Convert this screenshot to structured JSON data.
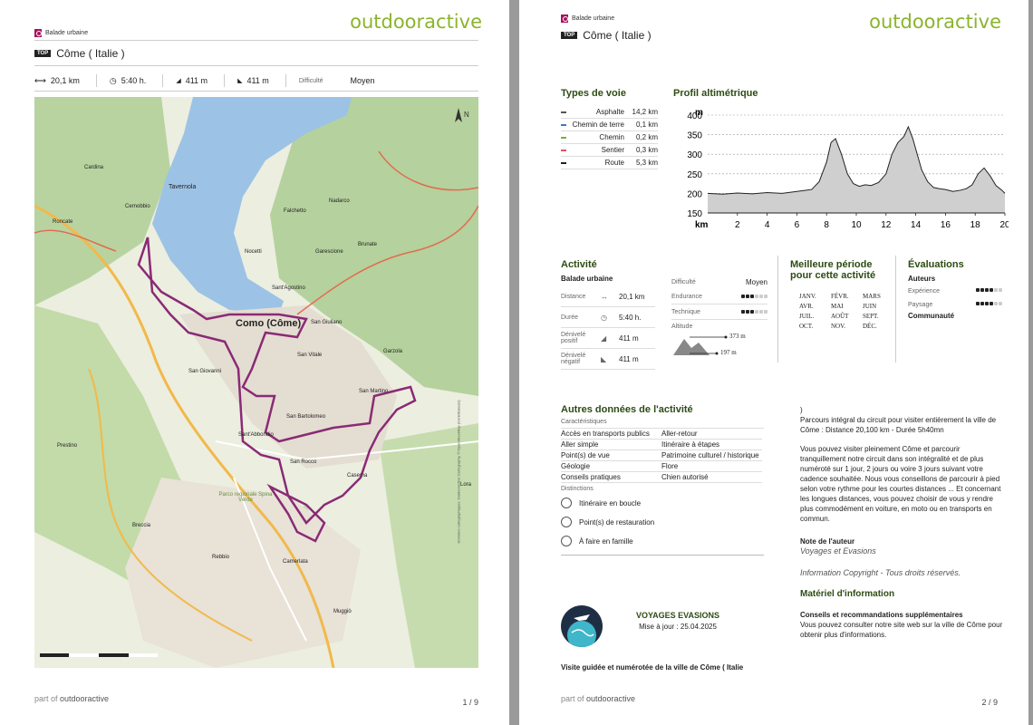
{
  "brand": "outdooractive",
  "page1": {
    "category": "Balade urbaine",
    "top_tag": "TOP",
    "title": "Côme ( Italie )",
    "stats": {
      "distance": "20,1 km",
      "duration": "5:40 h.",
      "ascent": "411 m",
      "descent": "411 m",
      "difficulty_label": "Difficulté",
      "difficulty": "Moyen"
    },
    "map": {
      "labels": [
        "Tavernola",
        "Cardina",
        "Roncate",
        "Cernobbio",
        "Nocetti",
        "Falchetto",
        "Nadarco",
        "Brunate",
        "Garescione",
        "Sant'Agostino",
        "Como (Côme)",
        "San Giuliano",
        "San Vitale",
        "San Giovanni",
        "San Martino",
        "San Bartolomeo",
        "Garzola",
        "Sant'Abbondio",
        "Prestino",
        "San Rocco",
        "Casema",
        "Breccia",
        "Rebbio",
        "Camerlata",
        "Muggiò",
        "Lora",
        "Parco regionale Spina Verde"
      ],
      "attribution": "Données cartographiques: Outdooractive Cartography, © OpenStreetMap (Contributeurs)"
    },
    "footer_prefix": "part of",
    "footer_brand": "outdooractive",
    "page_num": "1 / 9"
  },
  "page2": {
    "category": "Balade urbaine",
    "top_tag": "TOP",
    "title": "Côme ( Italie )",
    "surface_title": "Types de voie",
    "surfaces": [
      {
        "name": "Asphalte",
        "value": "14,2 km",
        "color": "#555555"
      },
      {
        "name": "Chemin de terre",
        "value": "0,1 km",
        "color": "#3a78c9"
      },
      {
        "name": "Chemin",
        "value": "0,2 km",
        "color": "#6fb43a"
      },
      {
        "name": "Sentier",
        "value": "0,3 km",
        "color": "#e05555"
      },
      {
        "name": "Route",
        "value": "5,3 km",
        "color": "#222222"
      }
    ],
    "profile_title": "Profil altimétrique",
    "chart_data": {
      "type": "area",
      "title": "Profil altimétrique",
      "xlabel": "km",
      "ylabel": "m",
      "xlim": [
        0,
        20
      ],
      "ylim": [
        150,
        400
      ],
      "xticks": [
        2,
        4,
        6,
        8,
        10,
        12,
        14,
        16,
        18,
        20
      ],
      "yticks": [
        150,
        200,
        250,
        300,
        350,
        400
      ],
      "x": [
        0,
        1,
        2,
        3,
        4,
        5,
        6,
        7,
        7.5,
        8,
        8.3,
        8.6,
        9,
        9.4,
        9.8,
        10.2,
        10.6,
        11,
        11.5,
        12,
        12.4,
        12.8,
        13.2,
        13.5,
        13.8,
        14.1,
        14.4,
        14.8,
        15.2,
        15.6,
        16,
        16.5,
        17,
        17.4,
        17.8,
        18.2,
        18.6,
        19,
        19.4,
        19.8,
        20
      ],
      "y": [
        200,
        198,
        201,
        199,
        202,
        200,
        205,
        210,
        230,
        280,
        330,
        340,
        300,
        250,
        225,
        218,
        222,
        220,
        228,
        250,
        300,
        330,
        345,
        370,
        340,
        300,
        260,
        230,
        215,
        212,
        210,
        205,
        208,
        212,
        222,
        250,
        265,
        245,
        220,
        208,
        200
      ],
      "grid": true
    },
    "activity": {
      "title": "Activité",
      "type": "Balade urbaine",
      "rows": [
        {
          "label": "Distance",
          "icon": "↔",
          "value": "20,1 km"
        },
        {
          "label": "Durée",
          "icon": "◷",
          "value": "5:40 h."
        },
        {
          "label": "Dénivelé positif",
          "icon": "◢",
          "value": "411 m"
        },
        {
          "label": "Dénivelé négatif",
          "icon": "◣",
          "value": "411 m"
        }
      ],
      "difficulty_label": "Difficulté",
      "difficulty_value": "Moyen",
      "endurance_label": "Endurance",
      "endurance_level": 3,
      "technique_label": "Technique",
      "technique_level": 3,
      "altitude_label": "Altitude",
      "alt_max": "373 m",
      "alt_min": "197 m"
    },
    "season": {
      "title": "Meilleure période pour cette activité",
      "months": [
        "JANV.",
        "FÉVR.",
        "MARS",
        "AVR.",
        "MAI",
        "JUIN",
        "JUIL.",
        "AOÛT",
        "SEPT.",
        "OCT.",
        "NOV.",
        "DÉC."
      ]
    },
    "ratings": {
      "title": "Évaluations",
      "authors_label": "Auteurs",
      "experience_label": "Expérience",
      "experience_level": 4,
      "landscape_label": "Paysage",
      "landscape_level": 4,
      "community_label": "Communauté"
    },
    "other": {
      "title": "Autres données de l'activité",
      "characteristics_label": "Caractéristiques",
      "characteristics": [
        [
          "Accès en transports publics",
          "Aller-retour"
        ],
        [
          "Aller simple",
          "Itinéraire à étapes"
        ],
        [
          "Point(s) de vue",
          "Patrimoine culturel / historique"
        ],
        [
          "Géologie",
          "Flore"
        ],
        [
          "Conseils pratiques",
          "Chien autorisé"
        ]
      ],
      "distinctions_label": "Distinctions",
      "distinctions": [
        "Itinéraire en boucle",
        "Point(s) de restauration",
        "À faire en famille"
      ]
    },
    "author": {
      "name": "VOYAGES EVASIONS",
      "updated": "Mise à jour : 25.04.2025"
    },
    "bottom_title": "Visite guidée et numérotée de la ville de Côme ( Italie",
    "desc": {
      "p0": ")",
      "p1": "Parcours intégral du circuit pour visiter entièrement la ville de Côme : Distance 20,100 km - Durée 5h40mn",
      "p2": "Vous pouvez visiter pleinement Côme et parcourir tranquillement notre circuit dans son intégralité et de plus numéroté sur 1 jour, 2 jours ou voire 3 jours suivant votre cadence souhaitée. Nous vous conseillons de parcourir à pied selon votre rythme pour les courtes distances ... Et concernant les longues distances, vous pouvez choisir de vous y rendre plus commodément en voiture, en moto ou en transports en commun.",
      "note_title": "Note de l'auteur",
      "note": "Voyages et Evasions",
      "copyright": "Information Copyright - Tous droits réservés.",
      "material_title": "Matériel d'information",
      "advice_title": "Conseils et recommandations supplémentaires",
      "advice": "Vous pouvez consulter notre site web sur la ville de Côme pour obtenir plus d'informations."
    },
    "footer_prefix": "part of",
    "footer_brand": "outdooractive",
    "page_num": "2 / 9"
  }
}
